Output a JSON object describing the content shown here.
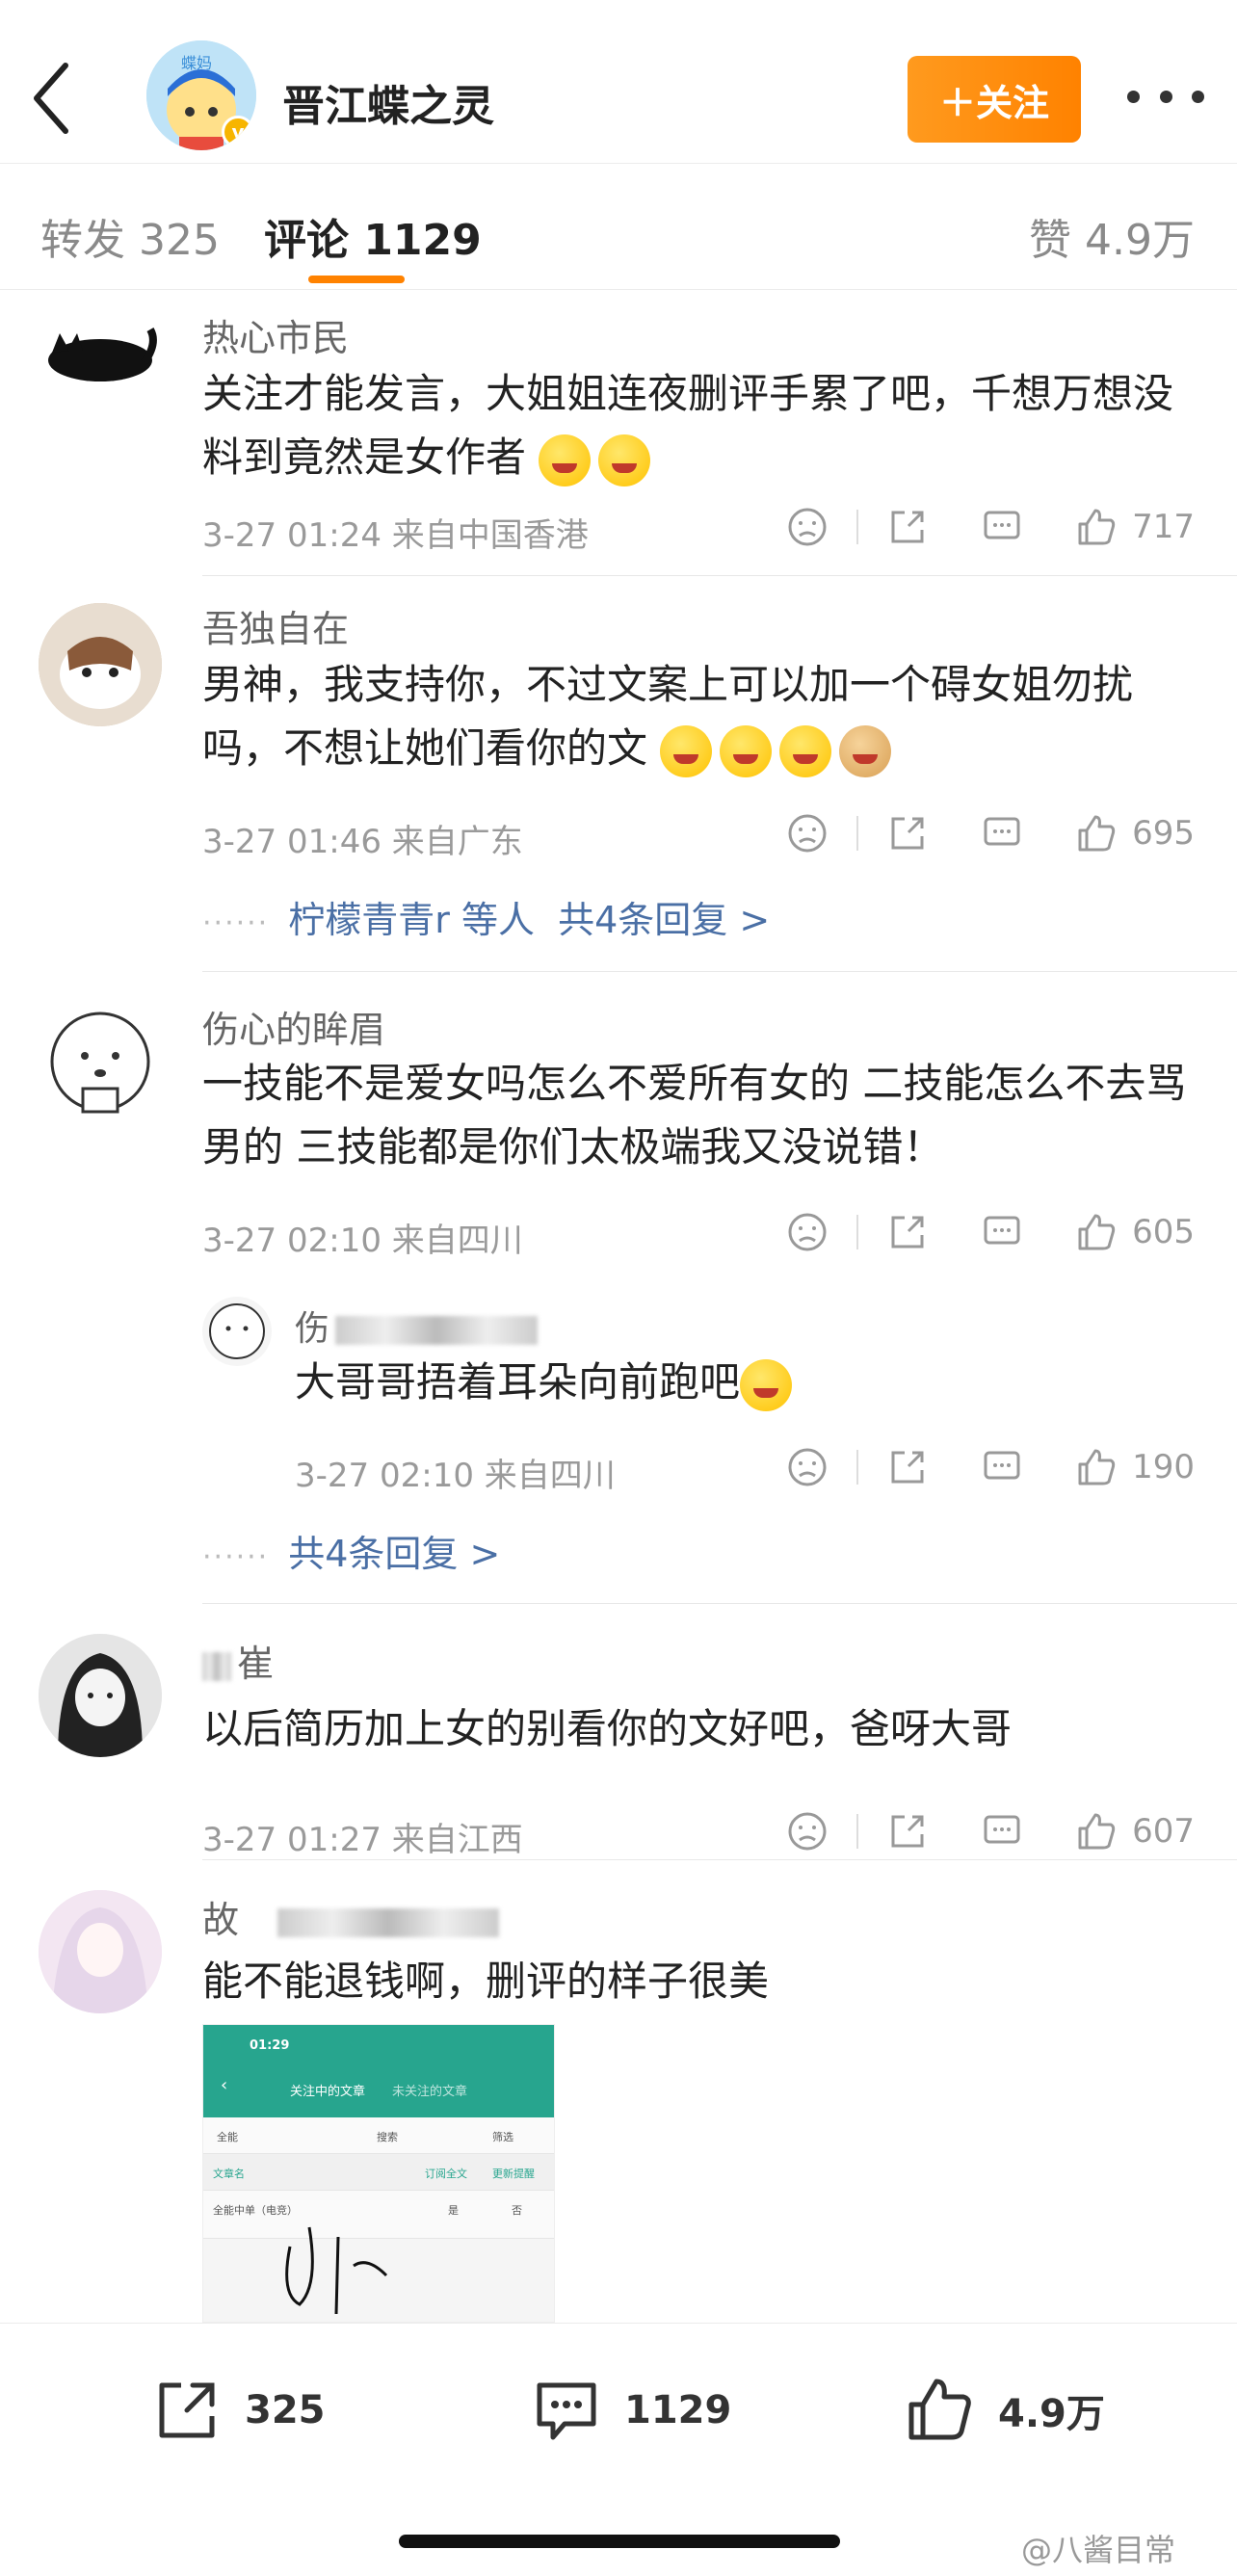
{
  "header": {
    "account_name": "晋江蝶之灵",
    "follow_label": "＋关注",
    "avatar_text": "蝶妈"
  },
  "tabs": {
    "repost": "转发 325",
    "comments": "评论 1129",
    "likes": "赞 4.9万"
  },
  "comments": [
    {
      "name": "热心市民",
      "text": "关注才能发言，大姐姐连夜删评手累了吧，千想万想没料到竟然是女作者",
      "date": "3-27 01:24  来自中国香港",
      "likes": "717"
    },
    {
      "name": "吾独自在",
      "text": "男神，我支持你，不过文案上可以加一个碍女姐勿扰吗，不想让她们看你的文",
      "date": "3-27 01:46  来自广东",
      "likes": "695",
      "replies_user": "柠檬青青r",
      "replies_suffix": "等人",
      "replies_count": "共4条回复 >"
    },
    {
      "name": "伤心的眸眉",
      "text": "一技能不是爱女吗怎么不爱所有女的 二技能怎么不去骂男的 三技能都是你们太极端我又没说错！",
      "date": "3-27 02:10  来自四川",
      "likes": "605",
      "sub_reply": {
        "name": "伤",
        "text": "大哥哥捂着耳朵向前跑吧",
        "date": "3-27 02:10  来自四川",
        "likes": "190"
      },
      "replies_count": "共4条回复 >"
    },
    {
      "name": "崔",
      "text": "以后简历加上女的别看你的文好吧，爸呀大哥",
      "date": "3-27 01:27  来自江西",
      "likes": "607"
    },
    {
      "name": "故",
      "text": "能不能退钱啊，删评的样子很美"
    }
  ],
  "thumbnail": {
    "time": "01:29",
    "tab_active": "关注中的文章",
    "tab_other": "未关注的文章",
    "filter_all": "全能",
    "search": "搜索",
    "filter": "筛选",
    "col_name": "文章名",
    "col_sub": "订阅全文",
    "col_update": "更新提醒",
    "row_title": "全能中单（电竞）",
    "row_yes": "是",
    "row_no": "否"
  },
  "bottom_bar": {
    "repost_count": "325",
    "comment_count": "1129",
    "like_count": "4.9万"
  },
  "watermark": "@八酱目常",
  "colors": {
    "accent": "#ff8200",
    "link": "#4a6fa5",
    "meta": "#9a9a9a"
  }
}
